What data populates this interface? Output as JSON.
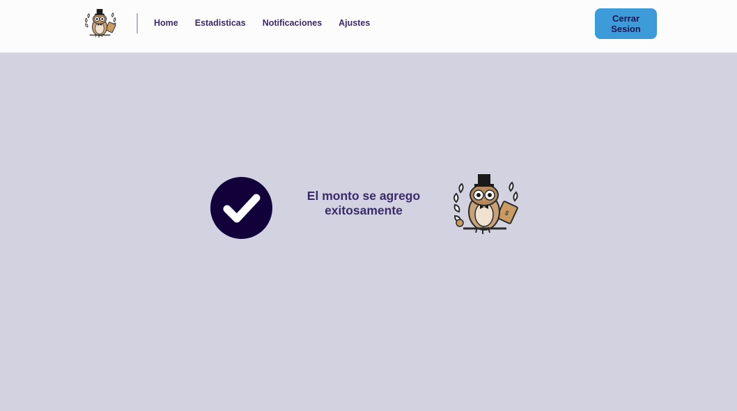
{
  "nav": {
    "links": [
      "Home",
      "Estadisticas",
      "Notificaciones",
      "Ajustes"
    ],
    "logout_label": "Cerrar\nSesion"
  },
  "main": {
    "message": "El monto se agrego exitosamente",
    "status_icon": "check-circle-icon",
    "mascot_icon": "owl-logo-icon"
  },
  "colors": {
    "nav_bg": "#fcfcfd",
    "page_bg": "#d3d2e1",
    "nav_text": "#3b2a66",
    "button_bg": "#3d9bda",
    "button_text": "#1b1551",
    "check_circle": "#12003a",
    "message_text": "#3c2a6b"
  }
}
